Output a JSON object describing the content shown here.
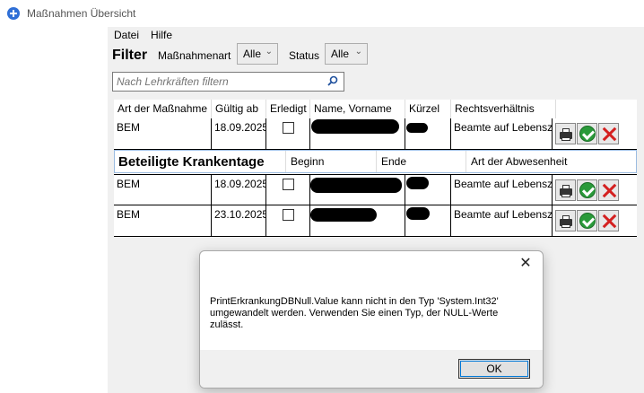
{
  "window": {
    "title": "Maßnahmen Übersicht"
  },
  "menu": {
    "items": [
      "Datei",
      "Hilfe"
    ]
  },
  "filter": {
    "label": "Filter",
    "massnahmenart_label": "Maßnahmenart",
    "massnahmenart_value": "Alle",
    "status_label": "Status",
    "status_value": "Alle",
    "search_placeholder": "Nach Lehrkräften filtern"
  },
  "grid": {
    "columns": [
      "Art der Maßnahme",
      "Gültig ab",
      "Erledigt",
      "Name, Vorname",
      "Kürzel",
      "Rechtsverhältnis"
    ],
    "rows": [
      {
        "art": "BEM",
        "gueltig": "18.09.2025",
        "recht": "Beamte auf Lebensze"
      }
    ]
  },
  "subgrid": {
    "title": "Beteiligte Krankentage",
    "columns": [
      "Beginn",
      "Ende",
      "Art der Abwesenheit"
    ],
    "rows": [
      {
        "art": "BEM",
        "gueltig": "18.09.2025",
        "recht": "Beamte auf Lebensze"
      },
      {
        "art": "BEM",
        "gueltig": "23.10.2025",
        "recht": "Beamte auf Lebensze"
      }
    ]
  },
  "dialog": {
    "close_glyph": "✕",
    "message": "PrintErkrankungDBNull.Value kann nicht in den Typ 'System.Int32'\numgewandelt werden. Verwenden Sie einen Typ, der NULL-Werte\nzulässt.",
    "ok_label": "OK"
  },
  "colors": {
    "accent": "#0078d7",
    "check_green": "#2a9a3a",
    "delete_red": "#d42020"
  }
}
